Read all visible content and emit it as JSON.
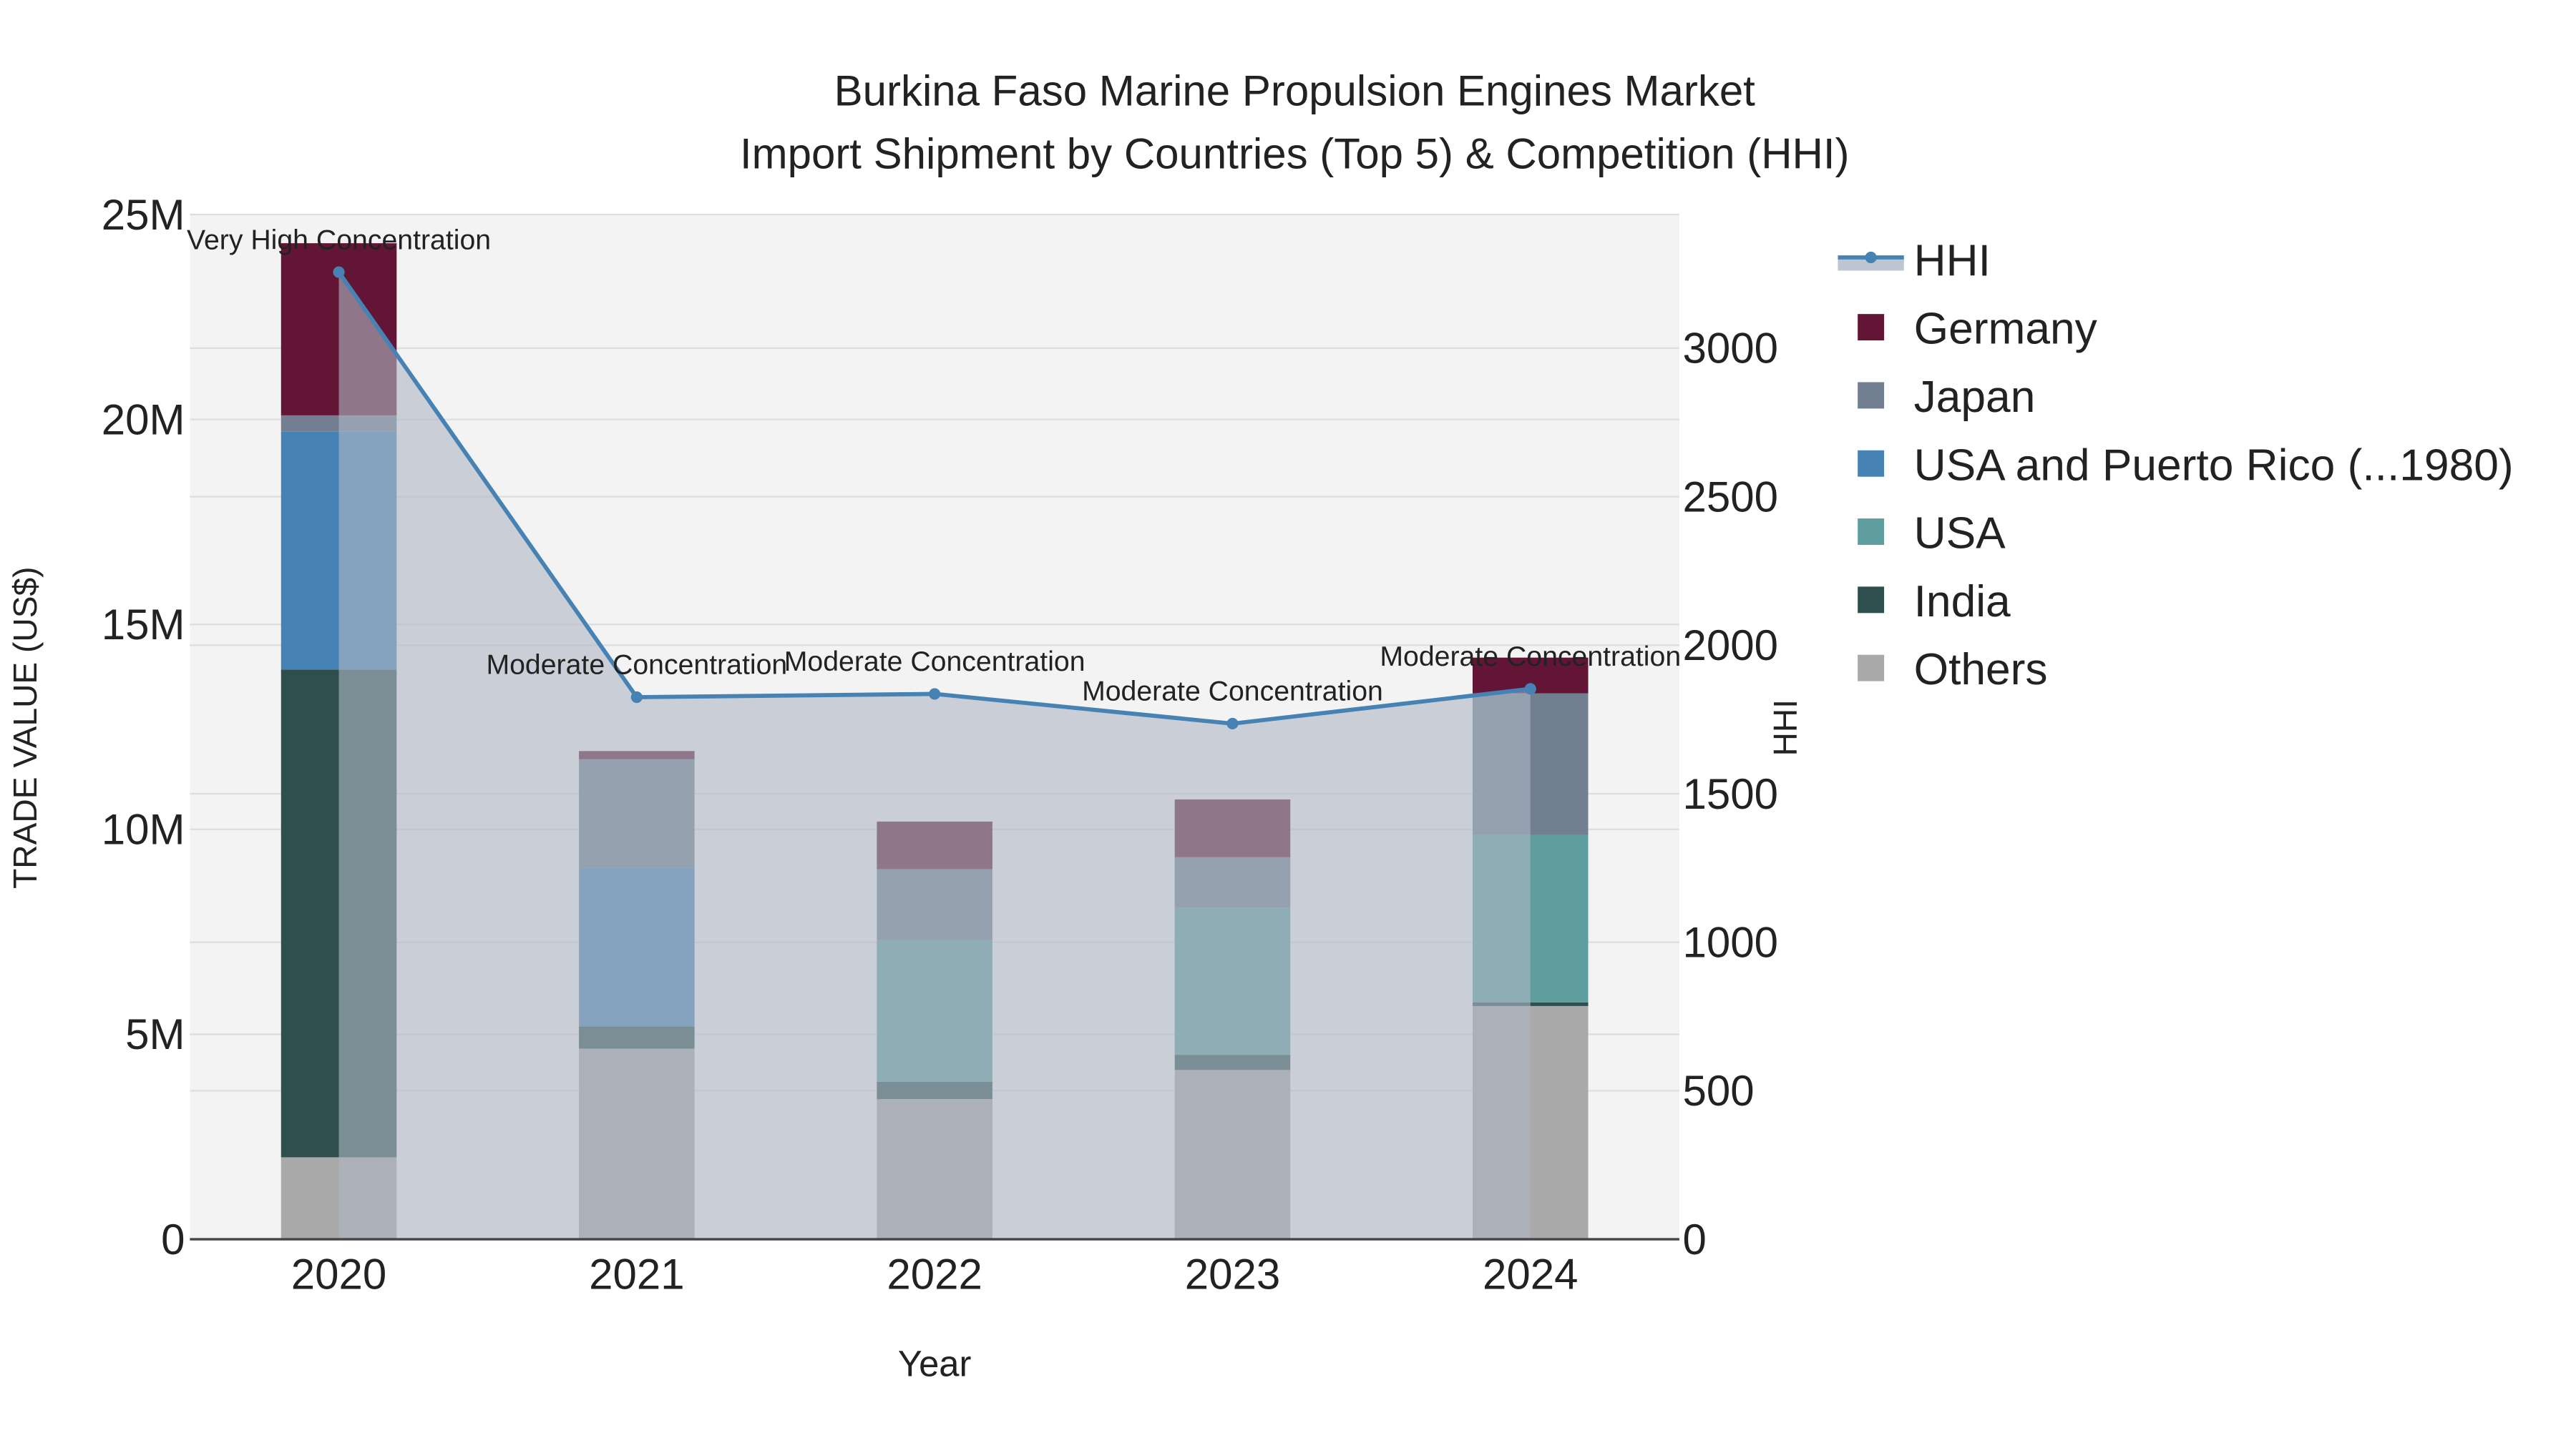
{
  "chart_data": {
    "type": "bar",
    "title_line1": "Burkina Faso Marine Propulsion Engines Market",
    "title_line2": "Import Shipment by Countries (Top 5) & Competition (HHI)",
    "xlabel": "Year",
    "ylabel": "TRADE VALUE (US$)",
    "y2label": "HHI",
    "categories": [
      "2020",
      "2021",
      "2022",
      "2023",
      "2024"
    ],
    "ylim": [
      0,
      25000000
    ],
    "y2lim": [
      0,
      3450
    ],
    "yticks": [
      {
        "v": 0,
        "label": "0"
      },
      {
        "v": 5000000,
        "label": "5M"
      },
      {
        "v": 10000000,
        "label": "10M"
      },
      {
        "v": 15000000,
        "label": "15M"
      },
      {
        "v": 20000000,
        "label": "20M"
      },
      {
        "v": 25000000,
        "label": "25M"
      }
    ],
    "y2ticks": [
      {
        "v": 0,
        "label": "0"
      },
      {
        "v": 500,
        "label": "500"
      },
      {
        "v": 1000,
        "label": "1000"
      },
      {
        "v": 1500,
        "label": "1500"
      },
      {
        "v": 2000,
        "label": "2000"
      },
      {
        "v": 2500,
        "label": "2500"
      },
      {
        "v": 3000,
        "label": "3000"
      }
    ],
    "series": [
      {
        "name": "Others",
        "color": "#a9a9a9",
        "values": [
          2000000,
          4650000,
          3420000,
          4130000,
          5690000
        ]
      },
      {
        "name": "India",
        "color": "#2f4f4f",
        "values": [
          11900000,
          540000,
          420000,
          370000,
          90000
        ]
      },
      {
        "name": "USA",
        "color": "#5f9e9e",
        "values": [
          0,
          0,
          3460000,
          3590000,
          4080000
        ]
      },
      {
        "name": "USA and Puerto Rico (...1980)",
        "color": "#4682b4",
        "values": [
          5800000,
          3880000,
          0,
          0,
          0
        ]
      },
      {
        "name": "Japan",
        "color": "#717f90",
        "values": [
          400000,
          2640000,
          1730000,
          1230000,
          3460000
        ]
      },
      {
        "name": "Germany",
        "color": "#631536",
        "values": [
          4200000,
          200000,
          1160000,
          1410000,
          870000
        ]
      }
    ],
    "hhi": {
      "name": "HHI",
      "color": "#4682b4",
      "values": [
        3256,
        1825,
        1836,
        1736,
        1853
      ],
      "annotations": [
        "Very High Concentration",
        "Moderate Concentration",
        "Moderate Concentration",
        "Moderate Concentration",
        "Moderate Concentration"
      ]
    },
    "legend": [
      "HHI",
      "Germany",
      "Japan",
      "USA and Puerto Rico (...1980)",
      "USA",
      "India",
      "Others"
    ],
    "legend_placement": "right",
    "grid": true
  }
}
